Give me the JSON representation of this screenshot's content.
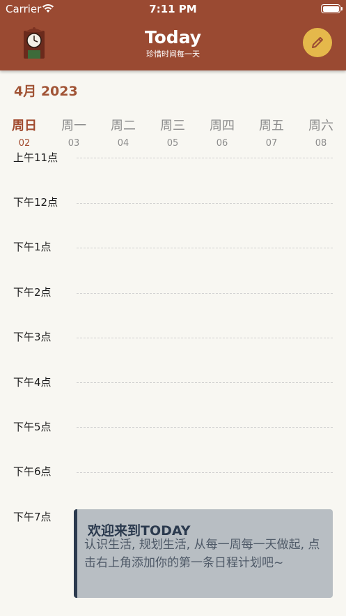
{
  "status_bar": {
    "carrier": "Carrier",
    "time": "7:11 PM"
  },
  "header": {
    "title": "Today",
    "subtitle": "珍惜时间每一天",
    "logo_icon": "clock-icon",
    "edit_icon": "pencil-icon"
  },
  "calendar": {
    "month_label": "4月 2023",
    "days": [
      {
        "name": "周日",
        "date": "02"
      },
      {
        "name": "周一",
        "date": "03"
      },
      {
        "name": "周二",
        "date": "04"
      },
      {
        "name": "周三",
        "date": "05"
      },
      {
        "name": "周四",
        "date": "06"
      },
      {
        "name": "周五",
        "date": "07"
      },
      {
        "name": "周六",
        "date": "08"
      }
    ],
    "selected_day": "周日"
  },
  "timeline": {
    "hours": [
      "上午11点",
      "下午12点",
      "下午1点",
      "下午2点",
      "下午3点",
      "下午4点",
      "下午5点",
      "下午6点",
      "下午7点"
    ]
  },
  "welcome_card": {
    "title": "欢迎来到TODAY",
    "body": "认识生活, 规划生活, 从每一周每一天做起, 点击右上角添加你的第一条日程计划吧~"
  },
  "colors": {
    "header_bg": "#9a4a32",
    "accent": "#a14a2e",
    "edit_button": "#e5b84b",
    "card_bg": "#b8bec3",
    "card_border": "#2b3a4e"
  }
}
